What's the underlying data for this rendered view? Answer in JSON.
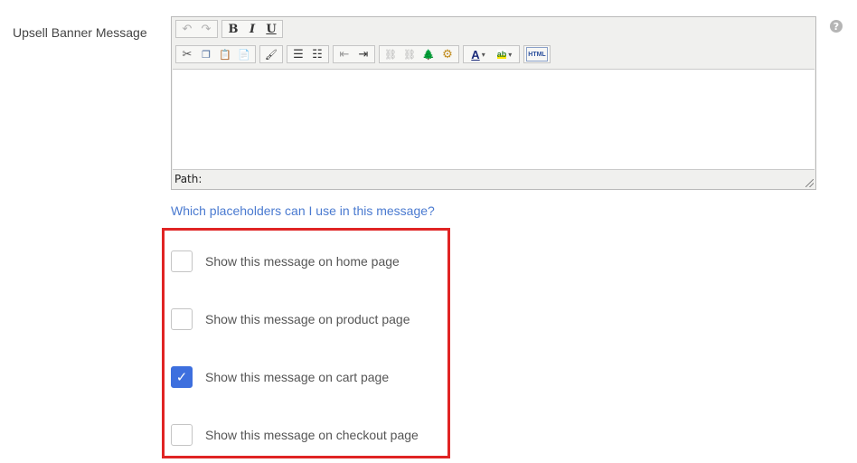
{
  "field": {
    "label": "Upsell Banner Message",
    "help_glyph": "?"
  },
  "toolbar": {
    "row1": [
      {
        "name": "undo-icon",
        "glyph": "↶",
        "disabled": true
      },
      {
        "name": "redo-icon",
        "glyph": "↷",
        "disabled": true
      },
      {
        "name": "bold-button",
        "glyph": "B",
        "style": "bold"
      },
      {
        "name": "italic-button",
        "glyph": "I",
        "style": "italic"
      },
      {
        "name": "underline-button",
        "glyph": "U",
        "style": "underline"
      }
    ],
    "row2": [
      {
        "name": "cut-icon",
        "glyph": "✂"
      },
      {
        "name": "copy-icon",
        "glyph": "❐"
      },
      {
        "name": "paste-icon",
        "glyph": "📋"
      },
      {
        "name": "paste-word-icon",
        "glyph": "📄"
      },
      {
        "name": "cleanup-icon",
        "glyph": "🖌"
      },
      {
        "name": "bullet-list-icon",
        "glyph": "☰"
      },
      {
        "name": "numbered-list-icon",
        "glyph": "☷"
      },
      {
        "name": "outdent-icon",
        "glyph": "⇤"
      },
      {
        "name": "indent-icon",
        "glyph": "⇥"
      },
      {
        "name": "link-icon",
        "glyph": "⛓",
        "disabled": true
      },
      {
        "name": "unlink-icon",
        "glyph": "⛓",
        "disabled": true
      },
      {
        "name": "image-icon",
        "glyph": "🌲"
      },
      {
        "name": "media-icon",
        "glyph": "⚙"
      },
      {
        "name": "text-color-icon",
        "glyph": "A",
        "caret": true
      },
      {
        "name": "highlight-color-icon",
        "glyph": "ab",
        "caret": true
      },
      {
        "name": "html-source-button",
        "glyph": "HTML"
      }
    ],
    "caret_glyph": "▾"
  },
  "editor": {
    "path_label": "Path:"
  },
  "placeholders_link": "Which placeholders can I use in this message?",
  "options": [
    {
      "label": "Show this message on home page",
      "checked": false
    },
    {
      "label": "Show this message on product page",
      "checked": false
    },
    {
      "label": "Show this message on cart page",
      "checked": true
    },
    {
      "label": "Show this message on checkout page",
      "checked": false
    }
  ],
  "check_glyph": "✓",
  "colors": {
    "accent": "#3d6fde",
    "link": "#4a7ad0",
    "highlight_border": "#e02424"
  }
}
